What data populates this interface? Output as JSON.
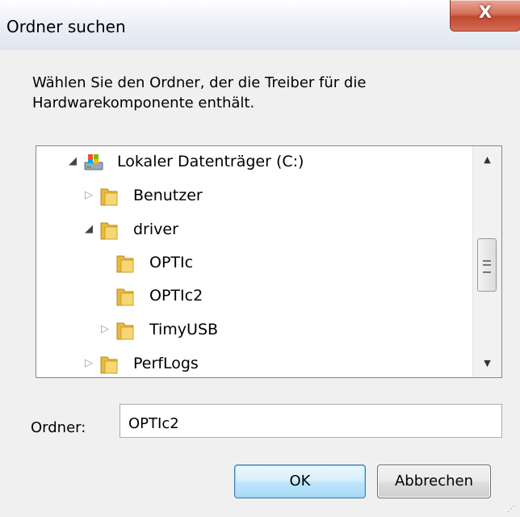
{
  "window": {
    "title": "Ordner suchen",
    "close_label": "X"
  },
  "instruction": "Wählen Sie den Ordner, der die Treiber für die Hardwarekomponente enthält.",
  "tree": {
    "items": [
      {
        "label": "Lokaler Datenträger (C:)",
        "icon": "drive-icon",
        "expander": "expanded"
      },
      {
        "label": "Benutzer",
        "icon": "folder-icon",
        "expander": "collapsed"
      },
      {
        "label": "driver",
        "icon": "folder-icon",
        "expander": "expanded"
      },
      {
        "label": "OPTIc",
        "icon": "folder-icon",
        "expander": "none"
      },
      {
        "label": "OPTIc2",
        "icon": "folder-icon",
        "expander": "none",
        "selected": true
      },
      {
        "label": "TimyUSB",
        "icon": "folder-icon",
        "expander": "collapsed"
      },
      {
        "label": "PerfLogs",
        "icon": "folder-icon",
        "expander": "collapsed"
      }
    ]
  },
  "folder_field": {
    "label": "Ordner:",
    "value": "OPTIc2"
  },
  "buttons": {
    "ok": "OK",
    "cancel": "Abbrechen"
  },
  "colors": {
    "close_button": "#c9523a",
    "selection": "#eceef2",
    "ok_border": "#3c7fb1"
  }
}
